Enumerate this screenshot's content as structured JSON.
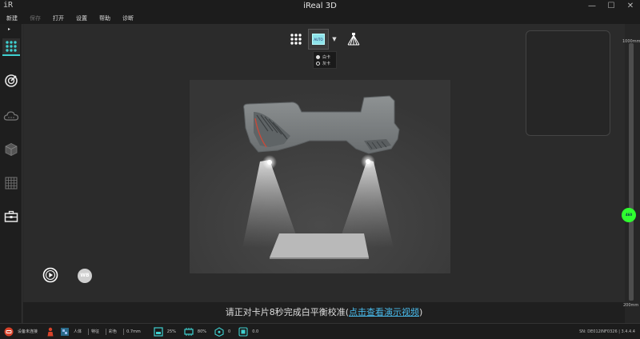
{
  "window": {
    "logo": "iR",
    "title": "iReal 3D",
    "minimize": "—",
    "maximize": "☐",
    "close": "✕"
  },
  "menu": {
    "items": [
      {
        "label": "新建",
        "enabled": true
      },
      {
        "label": "保存",
        "enabled": false
      },
      {
        "label": "打开",
        "enabled": true
      },
      {
        "label": "设置",
        "enabled": true
      },
      {
        "label": "帮助",
        "enabled": true
      },
      {
        "label": "诊断",
        "enabled": true
      }
    ]
  },
  "sidebar": {
    "expand_glyph": "▸",
    "items": [
      "scan-mode",
      "align",
      "cloud",
      "mesh",
      "grid",
      "toolbox"
    ],
    "active": "scan-mode"
  },
  "toolbar": {
    "auto_label": "AUTO",
    "dropdown_glyph": "▼"
  },
  "white_balance": {
    "options": [
      {
        "label": "白卡",
        "selected": true
      },
      {
        "label": "灰卡",
        "selected": false
      }
    ]
  },
  "controls": {
    "wb_label": "WB"
  },
  "instruction": {
    "text": "请正对卡片8秒完成白平衡校准(",
    "link": "点击查看演示视频",
    "tail": ")"
  },
  "distance": {
    "max_label": "1000mm",
    "min_label": "200mm",
    "current_label": "460",
    "min": 200,
    "max": 1000,
    "current": 460
  },
  "status": {
    "device": "设备未连接",
    "mode_person": "人体",
    "mode_feature": "特征",
    "mode_color": "彩色",
    "resolution": "0.7mm",
    "storage": "25%",
    "memory": "80%",
    "count": "0",
    "frame": "0.0",
    "serial": "SN: DE012INF0326",
    "version": "3.4.4.4"
  },
  "colors": {
    "accent": "#3fd0d0",
    "link": "#48b8e8",
    "knob": "#2fff2f",
    "device_icon": "#d9432b"
  }
}
